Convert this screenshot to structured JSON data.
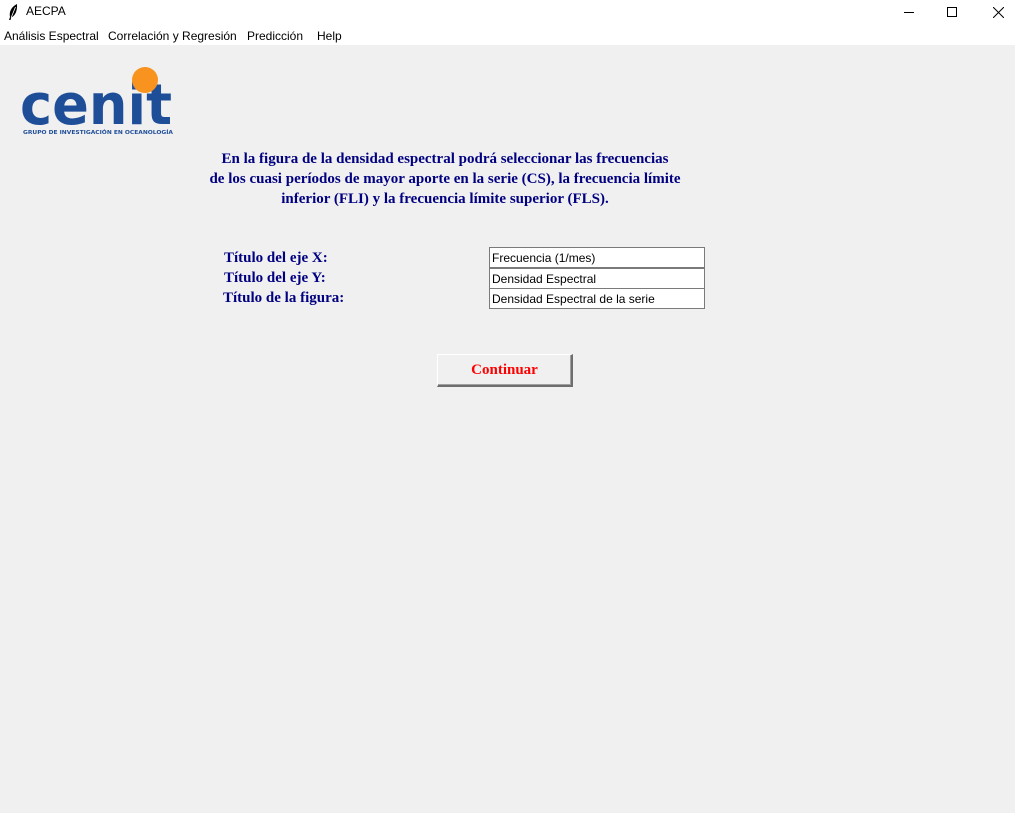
{
  "window": {
    "title": "AECPA",
    "minimize_icon": "minimize-icon",
    "maximize_icon": "maximize-icon",
    "close_icon": "close-icon"
  },
  "menu": {
    "items": [
      {
        "label": "Análisis Espectral"
      },
      {
        "label": "Correlación y Regresión"
      },
      {
        "label": "Predicción"
      },
      {
        "label": "Help"
      }
    ]
  },
  "logo": {
    "word": "Cenit",
    "caption": "GRUPO DE INVESTIGACIÓN EN OCEANOLOGÍA",
    "colors": {
      "blue": "#1f4e99",
      "orange": "#f7931e"
    }
  },
  "intro": {
    "lines": [
      "En la figura de la densidad espectral podrá seleccionar las frecuencias",
      "de los cuasi períodos de mayor aporte en la serie (CS), la frecuencia límite",
      "inferior (FLI) y la frecuencia límite superior (FLS)."
    ]
  },
  "form": {
    "x_label": "Título del eje X:",
    "x_value": "Frecuencia (1/mes)",
    "y_label": "Título del eje Y:",
    "y_value": "Densidad Espectral",
    "fig_label": "Título de la figura:",
    "fig_value": "Densidad Espectral de la serie"
  },
  "continue_button": {
    "label": "Continuar"
  },
  "colors": {
    "label_text": "#000080",
    "button_text": "#ff0000",
    "background": "#f0f0f0"
  }
}
